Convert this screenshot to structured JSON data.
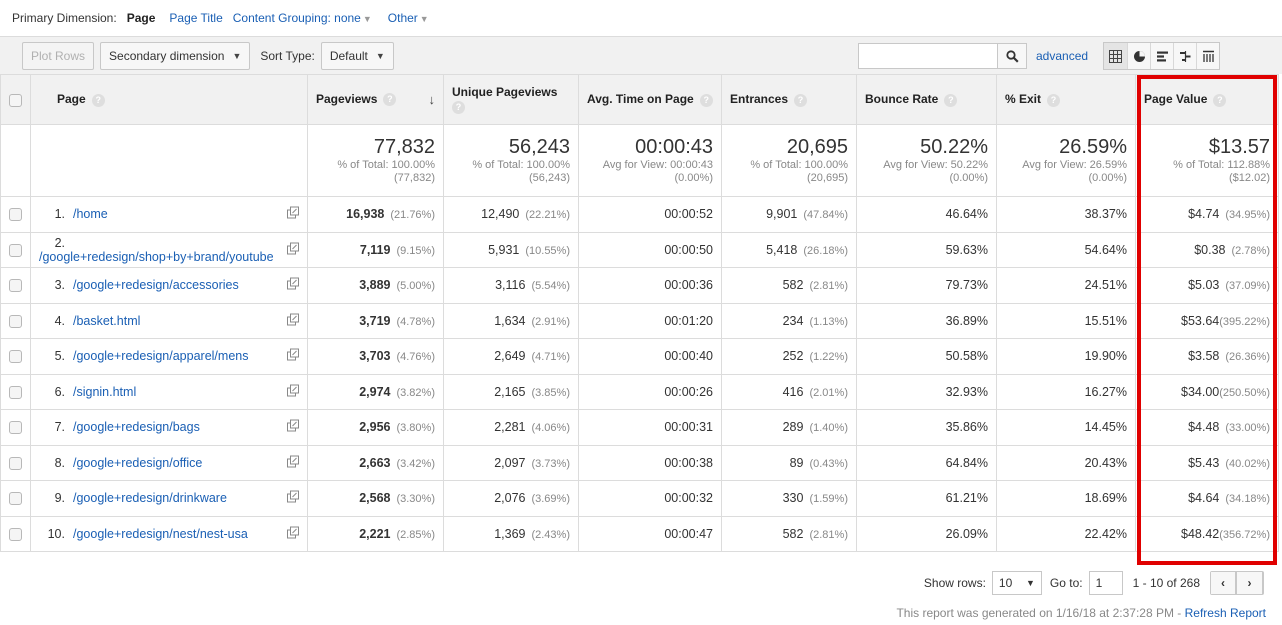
{
  "dimensions": {
    "label": "Primary Dimension:",
    "active": "Page",
    "options": [
      "Page Title",
      "Content Grouping: none"
    ],
    "other": "Other"
  },
  "toolbar": {
    "plot_rows": "Plot Rows",
    "secondary_dimension": "Secondary dimension",
    "sort_type_label": "Sort Type:",
    "sort_type_value": "Default",
    "search_value": "",
    "advanced": "advanced",
    "view_icons": [
      "table-view-icon",
      "pie-view-icon",
      "performance-view-icon",
      "comparison-view-icon",
      "pivot-view-icon"
    ]
  },
  "columns": {
    "page": "Page",
    "pageviews": "Pageviews",
    "unique_pageviews": "Unique Pageviews",
    "avg_time": "Avg. Time on Page",
    "entrances": "Entrances",
    "bounce_rate": "Bounce Rate",
    "exit": "% Exit",
    "page_value": "Page Value",
    "help": "?"
  },
  "totals": {
    "pageviews": {
      "value": "77,832",
      "line1": "% of Total: 100.00%",
      "line2": "(77,832)"
    },
    "unique_pageviews": {
      "value": "56,243",
      "line1": "% of Total: 100.00%",
      "line2": "(56,243)"
    },
    "avg_time": {
      "value": "00:00:43",
      "line1": "Avg for View: 00:00:43",
      "line2": "(0.00%)"
    },
    "entrances": {
      "value": "20,695",
      "line1": "% of Total: 100.00%",
      "line2": "(20,695)"
    },
    "bounce_rate": {
      "value": "50.22%",
      "line1": "Avg for View: 50.22%",
      "line2": "(0.00%)"
    },
    "exit": {
      "value": "26.59%",
      "line1": "Avg for View: 26.59%",
      "line2": "(0.00%)"
    },
    "page_value": {
      "value": "$13.57",
      "line1": "% of Total: 112.88%",
      "line2": "($12.02)"
    }
  },
  "rows": [
    {
      "rank": "1.",
      "page": "/home",
      "pv": "16,938",
      "pv_pct": "(21.76%)",
      "upv": "12,490",
      "upv_pct": "(22.21%)",
      "time": "00:00:52",
      "ent": "9,901",
      "ent_pct": "(47.84%)",
      "bounce": "46.64%",
      "exit": "38.37%",
      "value": "$4.74",
      "value_pct": "(34.95%)"
    },
    {
      "rank": "2.",
      "page": "/google+redesign/shop+by+brand/youtube",
      "pv": "7,119",
      "pv_pct": "(9.15%)",
      "upv": "5,931",
      "upv_pct": "(10.55%)",
      "time": "00:00:50",
      "ent": "5,418",
      "ent_pct": "(26.18%)",
      "bounce": "59.63%",
      "exit": "54.64%",
      "value": "$0.38",
      "value_pct": "(2.78%)"
    },
    {
      "rank": "3.",
      "page": "/google+redesign/accessories",
      "pv": "3,889",
      "pv_pct": "(5.00%)",
      "upv": "3,116",
      "upv_pct": "(5.54%)",
      "time": "00:00:36",
      "ent": "582",
      "ent_pct": "(2.81%)",
      "bounce": "79.73%",
      "exit": "24.51%",
      "value": "$5.03",
      "value_pct": "(37.09%)"
    },
    {
      "rank": "4.",
      "page": "/basket.html",
      "pv": "3,719",
      "pv_pct": "(4.78%)",
      "upv": "1,634",
      "upv_pct": "(2.91%)",
      "time": "00:01:20",
      "ent": "234",
      "ent_pct": "(1.13%)",
      "bounce": "36.89%",
      "exit": "15.51%",
      "value": "$53.64",
      "value_pct": "(395.22%)"
    },
    {
      "rank": "5.",
      "page": "/google+redesign/apparel/mens",
      "pv": "3,703",
      "pv_pct": "(4.76%)",
      "upv": "2,649",
      "upv_pct": "(4.71%)",
      "time": "00:00:40",
      "ent": "252",
      "ent_pct": "(1.22%)",
      "bounce": "50.58%",
      "exit": "19.90%",
      "value": "$3.58",
      "value_pct": "(26.36%)"
    },
    {
      "rank": "6.",
      "page": "/signin.html",
      "pv": "2,974",
      "pv_pct": "(3.82%)",
      "upv": "2,165",
      "upv_pct": "(3.85%)",
      "time": "00:00:26",
      "ent": "416",
      "ent_pct": "(2.01%)",
      "bounce": "32.93%",
      "exit": "16.27%",
      "value": "$34.00",
      "value_pct": "(250.50%)"
    },
    {
      "rank": "7.",
      "page": "/google+redesign/bags",
      "pv": "2,956",
      "pv_pct": "(3.80%)",
      "upv": "2,281",
      "upv_pct": "(4.06%)",
      "time": "00:00:31",
      "ent": "289",
      "ent_pct": "(1.40%)",
      "bounce": "35.86%",
      "exit": "14.45%",
      "value": "$4.48",
      "value_pct": "(33.00%)"
    },
    {
      "rank": "8.",
      "page": "/google+redesign/office",
      "pv": "2,663",
      "pv_pct": "(3.42%)",
      "upv": "2,097",
      "upv_pct": "(3.73%)",
      "time": "00:00:38",
      "ent": "89",
      "ent_pct": "(0.43%)",
      "bounce": "64.84%",
      "exit": "20.43%",
      "value": "$5.43",
      "value_pct": "(40.02%)"
    },
    {
      "rank": "9.",
      "page": "/google+redesign/drinkware",
      "pv": "2,568",
      "pv_pct": "(3.30%)",
      "upv": "2,076",
      "upv_pct": "(3.69%)",
      "time": "00:00:32",
      "ent": "330",
      "ent_pct": "(1.59%)",
      "bounce": "61.21%",
      "exit": "18.69%",
      "value": "$4.64",
      "value_pct": "(34.18%)"
    },
    {
      "rank": "10.",
      "page": "/google+redesign/nest/nest-usa",
      "pv": "2,221",
      "pv_pct": "(2.85%)",
      "upv": "1,369",
      "upv_pct": "(2.43%)",
      "time": "00:00:47",
      "ent": "582",
      "ent_pct": "(2.81%)",
      "bounce": "26.09%",
      "exit": "22.42%",
      "value": "$48.42",
      "value_pct": "(356.72%)"
    }
  ],
  "footer": {
    "show_rows_label": "Show rows:",
    "show_rows_value": "10",
    "goto_label": "Go to:",
    "goto_value": "1",
    "range": "1 - 10 of 268",
    "generated": "This report was generated on 1/16/18 at 2:37:28 PM - ",
    "refresh": "Refresh Report"
  },
  "colors": {
    "highlight_box": "#e00000",
    "link": "#1a5fb4"
  }
}
